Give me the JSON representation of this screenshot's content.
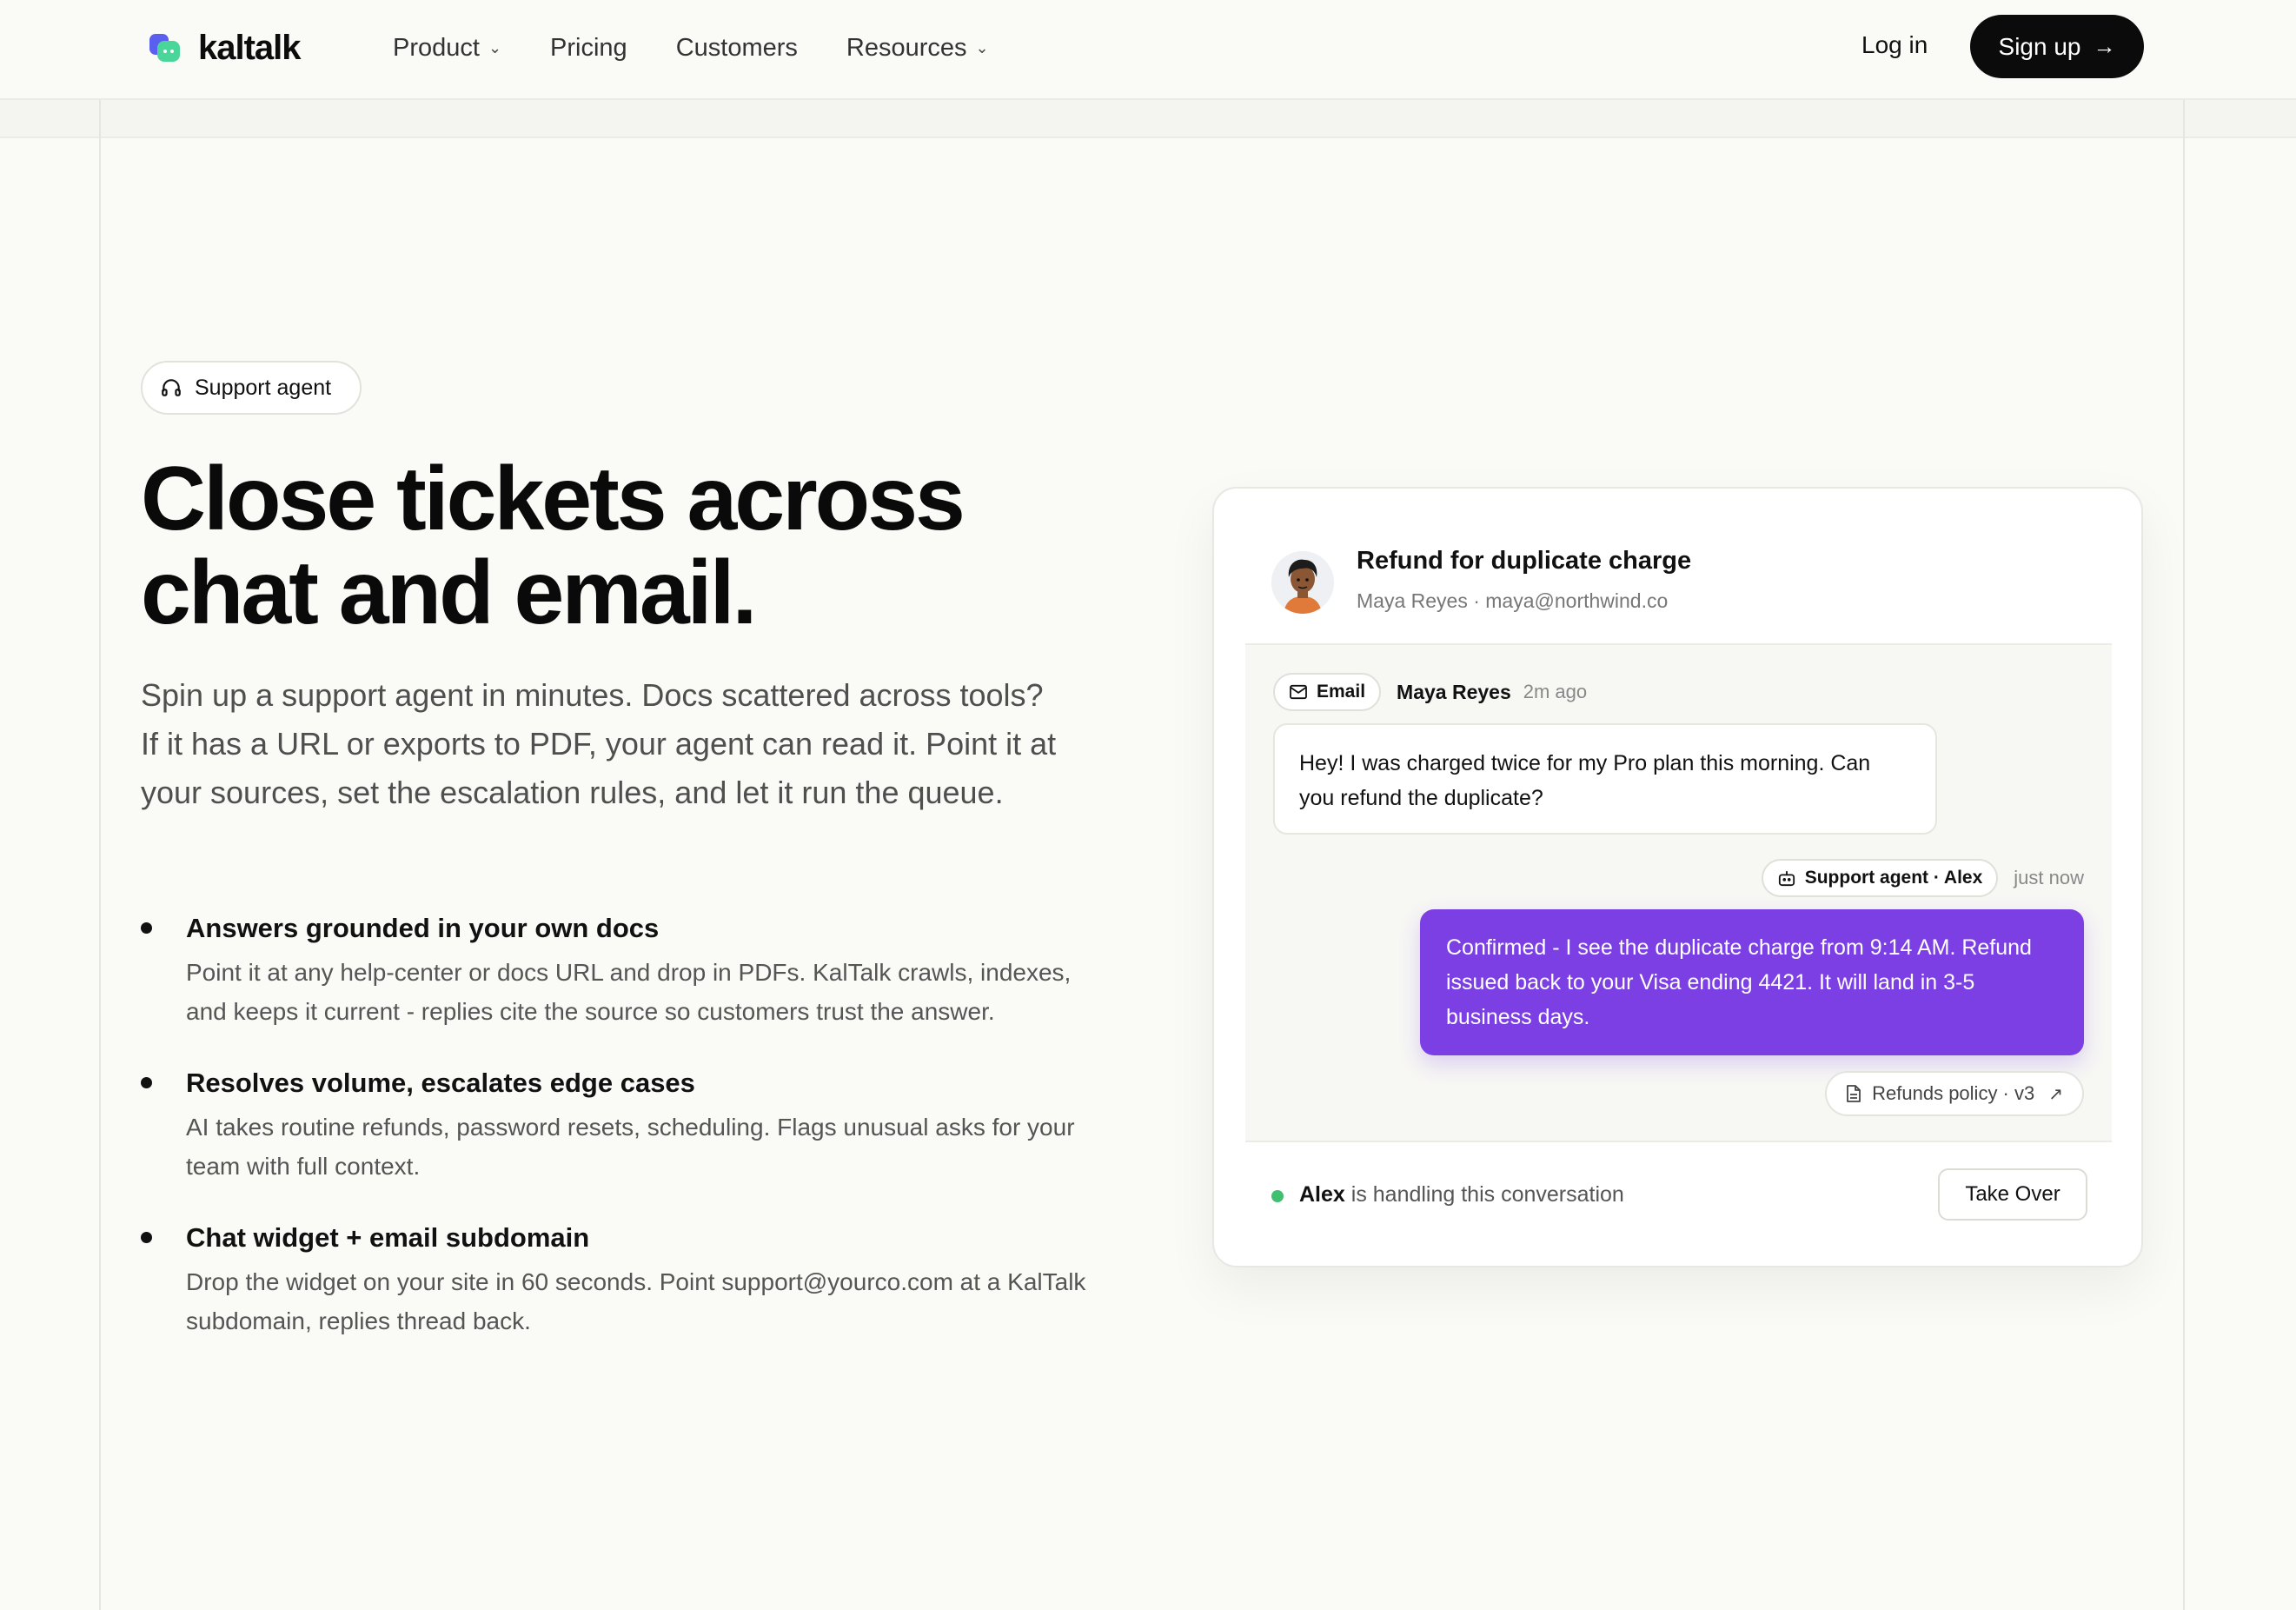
{
  "nav": {
    "brand": "kaltalk",
    "menu": [
      {
        "label": "Product",
        "has_dropdown": true
      },
      {
        "label": "Pricing",
        "has_dropdown": false
      },
      {
        "label": "Customers",
        "has_dropdown": false
      },
      {
        "label": "Resources",
        "has_dropdown": true
      }
    ],
    "login_label": "Log in",
    "signup_label": "Sign up"
  },
  "hero": {
    "pill_label": "Support agent",
    "headline_line1": "Close tickets across",
    "headline_line2": "chat and email.",
    "lead": "Spin up a support agent in minutes. Docs scattered across tools? If it has a URL or exports to PDF, your agent can read it. Point it at your sources, set the escalation rules, and let it run the queue."
  },
  "features": [
    {
      "title": "Answers grounded in your own docs",
      "body": "Point it at any help-center or docs URL and drop in PDFs. KalTalk crawls, indexes, and keeps it current - replies cite the source so customers trust the answer."
    },
    {
      "title": "Resolves volume, escalates edge cases",
      "body": "AI takes routine refunds, password resets, scheduling. Flags unusual asks for your team with full context."
    },
    {
      "title": "Chat widget + email subdomain",
      "body": "Drop the widget on your site in 60 seconds. Point support@yourco.com at a KalTalk subdomain, replies thread back."
    }
  ],
  "ticket": {
    "title": "Refund for duplicate charge",
    "customer": "Maya Reyes · maya@northwind.co",
    "channel_label": "Email",
    "sender": "Maya Reyes",
    "sender_time": "2m ago",
    "customer_message": "Hey! I was charged twice for my Pro plan this morning. Can you refund the duplicate?",
    "agent_label": "Support agent · Alex",
    "agent_time": "just now",
    "agent_message": "Confirmed - I see the duplicate charge from 9:14 AM. Refund issued back to your Visa ending 4421. It will land in 3-5 business days.",
    "source_label": "Refunds policy · v3",
    "handler_name": "Alex",
    "handler_text": " is handling this conversation",
    "takeover_label": "Take Over"
  },
  "colors": {
    "accent_purple": "#7b3fe4",
    "logo_blue": "#5b5ff0",
    "logo_green": "#4ad69a",
    "status_green": "#3fbf6f",
    "background": "#fafaf7"
  }
}
